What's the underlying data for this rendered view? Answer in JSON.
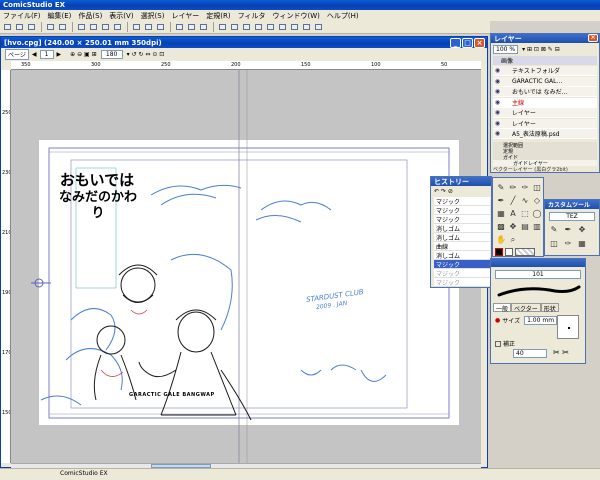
{
  "app": {
    "title": "ComicStudio EX"
  },
  "menu": [
    "ファイル(F)",
    "編集(E)",
    "作品(S)",
    "表示(V)",
    "選択(S)",
    "レイヤー",
    "定規(R)",
    "フィルタ",
    "ウィンドウ(W)",
    "ヘルプ(H)"
  ],
  "document": {
    "title": "[hvo.cpg] (240.00 × 250.01 mm 350dpi)",
    "page_label": "ページ",
    "page_value": "1",
    "zoom_value": "180",
    "ruler_h": [
      "350",
      "300",
      "250",
      "200",
      "150",
      "100",
      "50"
    ],
    "ruler_v": [
      "250",
      "230",
      "210",
      "190",
      "170",
      "150"
    ],
    "vertical_text": [
      "おもいでは",
      "なみだのかわり"
    ],
    "credit": "GARACTIC GALE BANGWAP",
    "signature": [
      "STARDUST CLUB",
      "2009 . JAN"
    ]
  },
  "layers": {
    "title": "レイヤー",
    "zoom": "100 %",
    "header": "画像",
    "items": [
      {
        "name": "テキストフォルダ",
        "active": false
      },
      {
        "name": "GARACTIC GAL…",
        "active": false
      },
      {
        "name": "おもいでは なみだ…",
        "active": false
      },
      {
        "name": "主線",
        "active": true
      },
      {
        "name": "レイヤー",
        "active": false
      },
      {
        "name": "レイヤー",
        "active": false
      },
      {
        "name": "A5_表法原稿.psd",
        "active": false
      }
    ],
    "sections": [
      "選択範囲",
      "定規",
      "ガイド"
    ],
    "guide_item": "ガイドレイヤー",
    "footer": "ベクターレイヤー (黒白グラ2bit)"
  },
  "history": {
    "title": "ヒストリー",
    "items": [
      "マジック",
      "マジック",
      "マジック",
      "消しゴム",
      "消しゴム",
      "曲線",
      "消しゴム",
      "マジック",
      "マジック",
      "マジック"
    ],
    "selected_index": 7
  },
  "custom_tool": {
    "title": "カスタムツール",
    "value": "TEZ"
  },
  "tool_props": {
    "tabs": [
      "一般",
      "ベクター",
      "形状"
    ],
    "size_label": "サイズ",
    "size_value": "1.00 mm",
    "correction_label": "補正",
    "correction_value": "40",
    "number": "101"
  },
  "statusbar": {
    "text": "ComicStudio EX"
  },
  "colors": {
    "accent": "#0a5fd8",
    "line_blue": "#4a7fd0",
    "ink": "#1a1a1a"
  }
}
